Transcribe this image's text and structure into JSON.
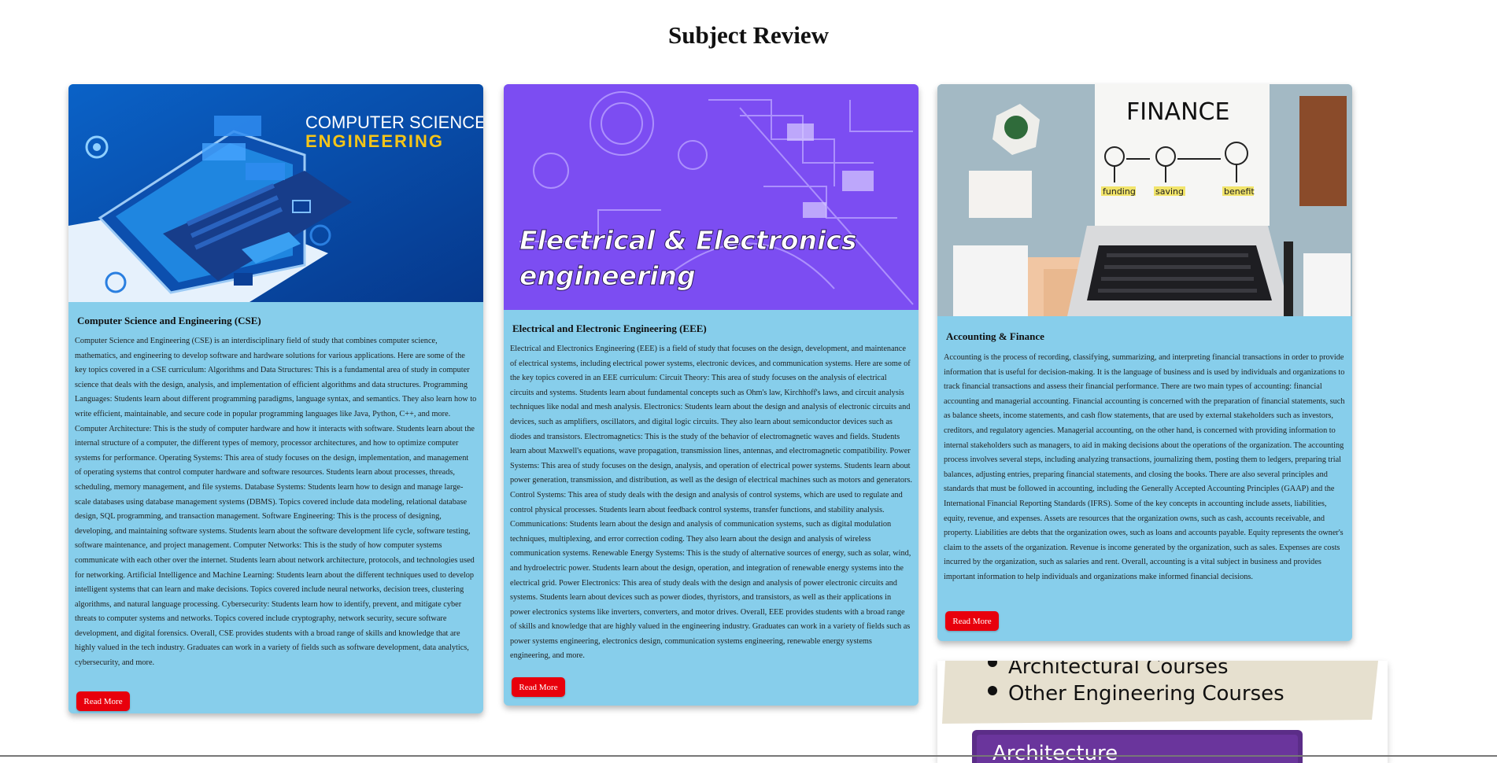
{
  "page": {
    "title": "Subject Review"
  },
  "cards": [
    {
      "image_text": [
        "COMPUTER SCIENCE",
        "ENGINEERING"
      ],
      "title": "Computer Science and Engineering (CSE)",
      "body": "Computer Science and Engineering (CSE) is an interdisciplinary field of study that combines computer science, mathematics, and engineering to develop software and hardware solutions for various applications. Here are some of the key topics covered in a CSE curriculum: Algorithms and Data Structures: This is a fundamental area of study in computer science that deals with the design, analysis, and implementation of efficient algorithms and data structures. Programming Languages: Students learn about different programming paradigms, language syntax, and semantics. They also learn how to write efficient, maintainable, and secure code in popular programming languages like Java, Python, C++, and more. Computer Architecture: This is the study of computer hardware and how it interacts with software. Students learn about the internal structure of a computer, the different types of memory, processor architectures, and how to optimize computer systems for performance. Operating Systems: This area of study focuses on the design, implementation, and management of operating systems that control computer hardware and software resources. Students learn about processes, threads, scheduling, memory management, and file systems. Database Systems: Students learn how to design and manage large-scale databases using database management systems (DBMS). Topics covered include data modeling, relational database design, SQL programming, and transaction management. Software Engineering: This is the process of designing, developing, and maintaining software systems. Students learn about the software development life cycle, software testing, software maintenance, and project management. Computer Networks: This is the study of how computer systems communicate with each other over the internet. Students learn about network architecture, protocols, and technologies used for networking. Artificial Intelligence and Machine Learning: Students learn about the different techniques used to develop intelligent systems that can learn and make decisions. Topics covered include neural networks, decision trees, clustering algorithms, and natural language processing. Cybersecurity: Students learn how to identify, prevent, and mitigate cyber threats to computer systems and networks. Topics covered include cryptography, network security, secure software development, and digital forensics. Overall, CSE provides students with a broad range of skills and knowledge that are highly valued in the tech industry. Graduates can work in a variety of fields such as software development, data analytics, cybersecurity, and more.",
      "button": "Read More"
    },
    {
      "image_text": [
        "Electrical & Electronics",
        "engineering"
      ],
      "title": "Electrical and Electronic Engineering (EEE)",
      "body": "Electrical and Electronics Engineering (EEE) is a field of study that focuses on the design, development, and maintenance of electrical systems, including electrical power systems, electronic devices, and communication systems. Here are some of the key topics covered in an EEE curriculum: Circuit Theory: This area of study focuses on the analysis of electrical circuits and systems. Students learn about fundamental concepts such as Ohm's law, Kirchhoff's laws, and circuit analysis techniques like nodal and mesh analysis. Electronics: Students learn about the design and analysis of electronic circuits and devices, such as amplifiers, oscillators, and digital logic circuits. They also learn about semiconductor devices such as diodes and transistors. Electromagnetics: This is the study of the behavior of electromagnetic waves and fields. Students learn about Maxwell's equations, wave propagation, transmission lines, antennas, and electromagnetic compatibility. Power Systems: This area of study focuses on the design, analysis, and operation of electrical power systems. Students learn about power generation, transmission, and distribution, as well as the design of electrical machines such as motors and generators. Control Systems: This area of study deals with the design and analysis of control systems, which are used to regulate and control physical processes. Students learn about feedback control systems, transfer functions, and stability analysis. Communications: Students learn about the design and analysis of communication systems, such as digital modulation techniques, multiplexing, and error correction coding. They also learn about the design and analysis of wireless communication systems. Renewable Energy Systems: This is the study of alternative sources of energy, such as solar, wind, and hydroelectric power. Students learn about the design, operation, and integration of renewable energy systems into the electrical grid. Power Electronics: This area of study deals with the design and analysis of power electronic circuits and systems. Students learn about devices such as power diodes, thyristors, and transistors, as well as their applications in power electronics systems like inverters, converters, and motor drives. Overall, EEE provides students with a broad range of skills and knowledge that are highly valued in the engineering industry. Graduates can work in a variety of fields such as power systems engineering, electronics design, communication systems engineering, renewable energy systems engineering, and more.",
      "button": "Read More"
    },
    {
      "image_text": [
        "FINANCE",
        "funding",
        "saving",
        "benefit"
      ],
      "title": "Accounting & Finance",
      "body": "Accounting is the process of recording, classifying, summarizing, and interpreting financial transactions in order to provide information that is useful for decision-making. It is the language of business and is used by individuals and organizations to track financial transactions and assess their financial performance. There are two main types of accounting: financial accounting and managerial accounting. Financial accounting is concerned with the preparation of financial statements, such as balance sheets, income statements, and cash flow statements, that are used by external stakeholders such as investors, creditors, and regulatory agencies. Managerial accounting, on the other hand, is concerned with providing information to internal stakeholders such as managers, to aid in making decisions about the operations of the organization. The accounting process involves several steps, including analyzing transactions, journalizing them, posting them to ledgers, preparing trial balances, adjusting entries, preparing financial statements, and closing the books. There are also several principles and standards that must be followed in accounting, including the Generally Accepted Accounting Principles (GAAP) and the International Financial Reporting Standards (IFRS). Some of the key concepts in accounting include assets, liabilities, equity, revenue, and expenses. Assets are resources that the organization owns, such as cash, accounts receivable, and property. Liabilities are debts that the organization owes, such as loans and accounts payable. Equity represents the owner's claim to the assets of the organization. Revenue is income generated by the organization, such as sales. Expenses are costs incurred by the organization, such as salaries and rent. Overall, accounting is a vital subject in business and provides important information to help individuals and organizations make informed financial decisions.",
      "button": "Read More"
    },
    {
      "image_text": [
        "Architectural Courses",
        "Other Engineering Courses",
        "Architecture"
      ]
    }
  ],
  "colors": {
    "card_bg": "#87ceeb",
    "button_bg": "#e8000c",
    "button_text": "#ffffff"
  }
}
